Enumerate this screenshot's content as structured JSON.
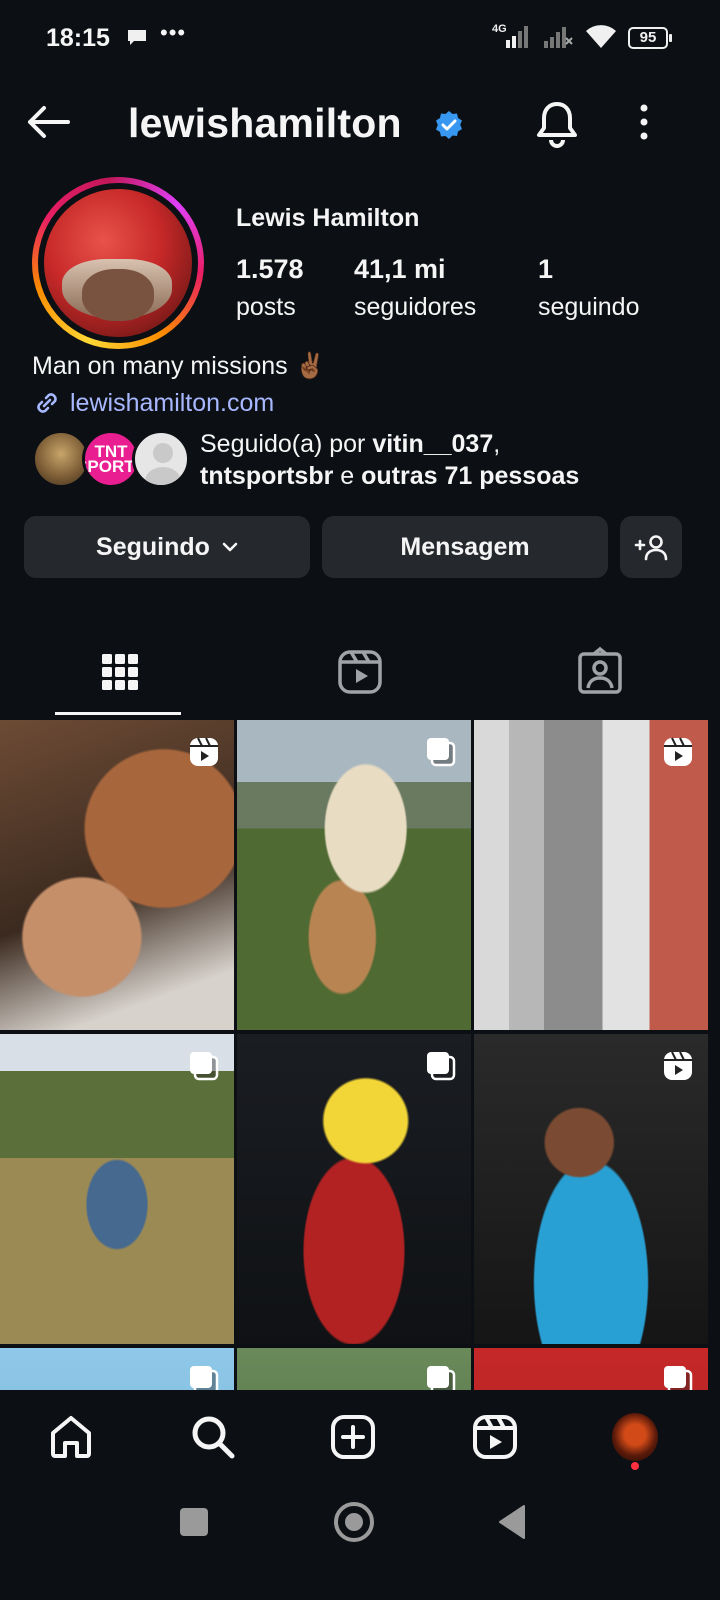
{
  "status_bar": {
    "time": "18:15",
    "network": "4G",
    "battery": "95"
  },
  "header": {
    "username": "lewishamilton",
    "verified": true
  },
  "profile": {
    "full_name": "Lewis Hamilton",
    "stats": [
      {
        "value": "1.578",
        "label": "posts"
      },
      {
        "value": "41,1 mi",
        "label": "seguidores"
      },
      {
        "value": "1",
        "label": "seguindo"
      }
    ],
    "bio": "Man on many missions ✌🏾",
    "link": "lewishamilton.com",
    "followed_by": {
      "prefix": "Seguido(a) por ",
      "user1": "vitin__037",
      "separator": ",",
      "user2": "tntsportsbr",
      "conjunction": " e ",
      "others": "outras 71 pessoas",
      "tnt_logo_text": "TNT SPORTS"
    }
  },
  "actions": {
    "following_label": "Seguindo",
    "message_label": "Mensagem"
  },
  "tabs": [
    {
      "name": "posts-grid",
      "active": true
    },
    {
      "name": "reels",
      "active": false
    },
    {
      "name": "tagged",
      "active": false
    }
  ],
  "grid": [
    {
      "type": "reel"
    },
    {
      "type": "carousel"
    },
    {
      "type": "reel"
    },
    {
      "type": "carousel"
    },
    {
      "type": "carousel"
    },
    {
      "type": "reel"
    },
    {
      "type": "carousel"
    },
    {
      "type": "carousel"
    },
    {
      "type": "carousel"
    }
  ],
  "colors": {
    "background": "#0c1014",
    "button_bg": "#25292e",
    "link": "#a7b8ff",
    "verified": "#3897f0",
    "notification_dot": "#ff3040"
  }
}
